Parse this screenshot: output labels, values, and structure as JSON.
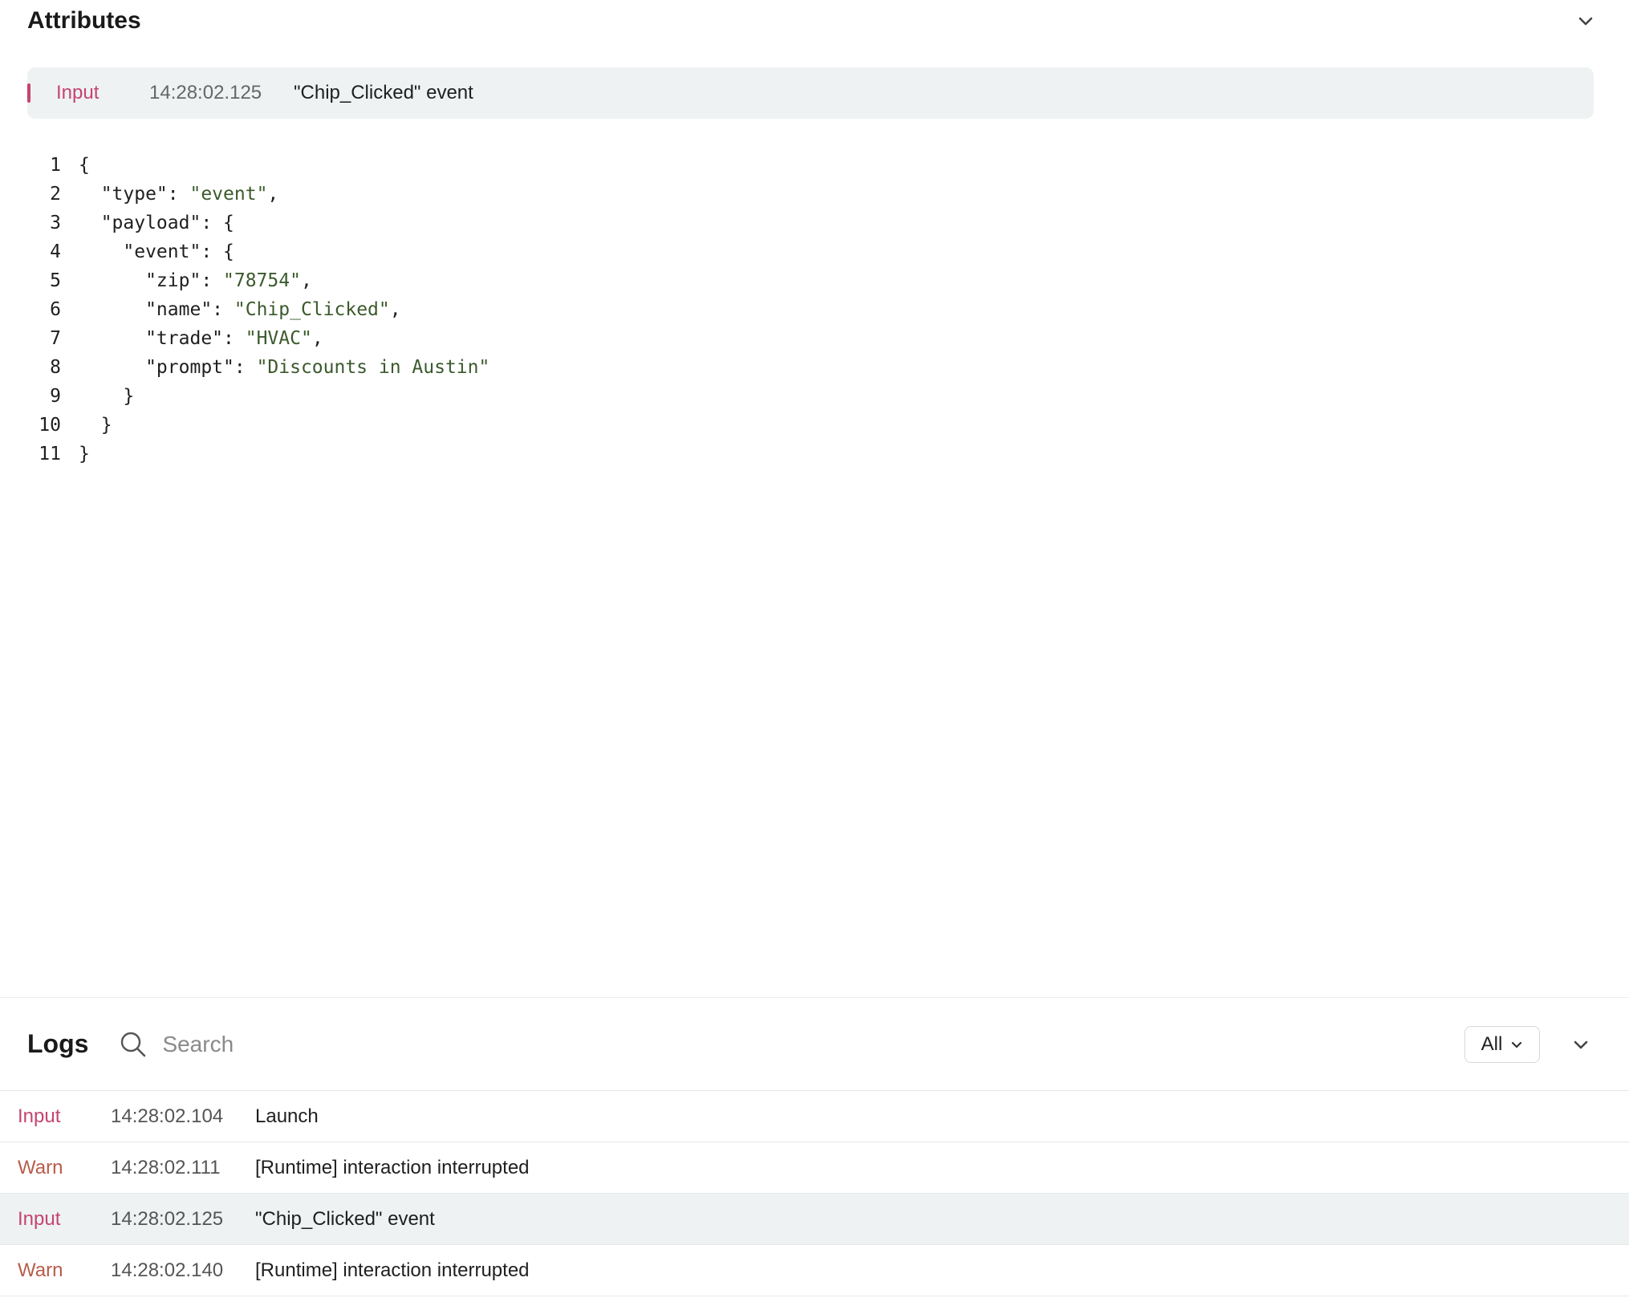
{
  "attributes": {
    "title": "Attributes",
    "selected_event": {
      "type": "Input",
      "time": "14:28:02.125",
      "message": "\"Chip_Clicked\" event"
    },
    "code_lines": [
      {
        "n": "1",
        "parts": [
          {
            "t": "{",
            "s": false
          }
        ]
      },
      {
        "n": "2",
        "parts": [
          {
            "t": "  \"type\": ",
            "s": false
          },
          {
            "t": "\"event\"",
            "s": true
          },
          {
            "t": ",",
            "s": false
          }
        ]
      },
      {
        "n": "3",
        "parts": [
          {
            "t": "  \"payload\": {",
            "s": false
          }
        ]
      },
      {
        "n": "4",
        "parts": [
          {
            "t": "    \"event\": {",
            "s": false
          }
        ]
      },
      {
        "n": "5",
        "parts": [
          {
            "t": "      \"zip\": ",
            "s": false
          },
          {
            "t": "\"78754\"",
            "s": true
          },
          {
            "t": ",",
            "s": false
          }
        ]
      },
      {
        "n": "6",
        "parts": [
          {
            "t": "      \"name\": ",
            "s": false
          },
          {
            "t": "\"Chip_Clicked\"",
            "s": true
          },
          {
            "t": ",",
            "s": false
          }
        ]
      },
      {
        "n": "7",
        "parts": [
          {
            "t": "      \"trade\": ",
            "s": false
          },
          {
            "t": "\"HVAC\"",
            "s": true
          },
          {
            "t": ",",
            "s": false
          }
        ]
      },
      {
        "n": "8",
        "parts": [
          {
            "t": "      \"prompt\": ",
            "s": false
          },
          {
            "t": "\"Discounts in Austin\"",
            "s": true
          }
        ]
      },
      {
        "n": "9",
        "parts": [
          {
            "t": "    }",
            "s": false
          }
        ]
      },
      {
        "n": "10",
        "parts": [
          {
            "t": "  }",
            "s": false
          }
        ]
      },
      {
        "n": "11",
        "parts": [
          {
            "t": "}",
            "s": false
          }
        ]
      }
    ]
  },
  "logs": {
    "title": "Logs",
    "search": {
      "placeholder": "Search",
      "value": ""
    },
    "filter": {
      "selected": "All"
    },
    "rows": [
      {
        "type": "Input",
        "kind": "input",
        "time": "14:28:02.104",
        "message": "Launch",
        "selected": false
      },
      {
        "type": "Warn",
        "kind": "warn",
        "time": "14:28:02.111",
        "message": "[Runtime] interaction interrupted",
        "selected": false
      },
      {
        "type": "Input",
        "kind": "input",
        "time": "14:28:02.125",
        "message": "\"Chip_Clicked\" event",
        "selected": true
      },
      {
        "type": "Warn",
        "kind": "warn",
        "time": "14:28:02.140",
        "message": "[Runtime] interaction interrupted",
        "selected": false
      }
    ]
  },
  "colors": {
    "input": "#c4456f",
    "warn": "#b85c4a",
    "string": "#3b5a2c",
    "selected_bg": "#eef2f3"
  },
  "icons": {
    "attributes_collapse": "chevron-down-icon",
    "search": "search-icon",
    "filter_dropdown": "chevron-down-icon",
    "logs_collapse": "chevron-down-icon"
  }
}
